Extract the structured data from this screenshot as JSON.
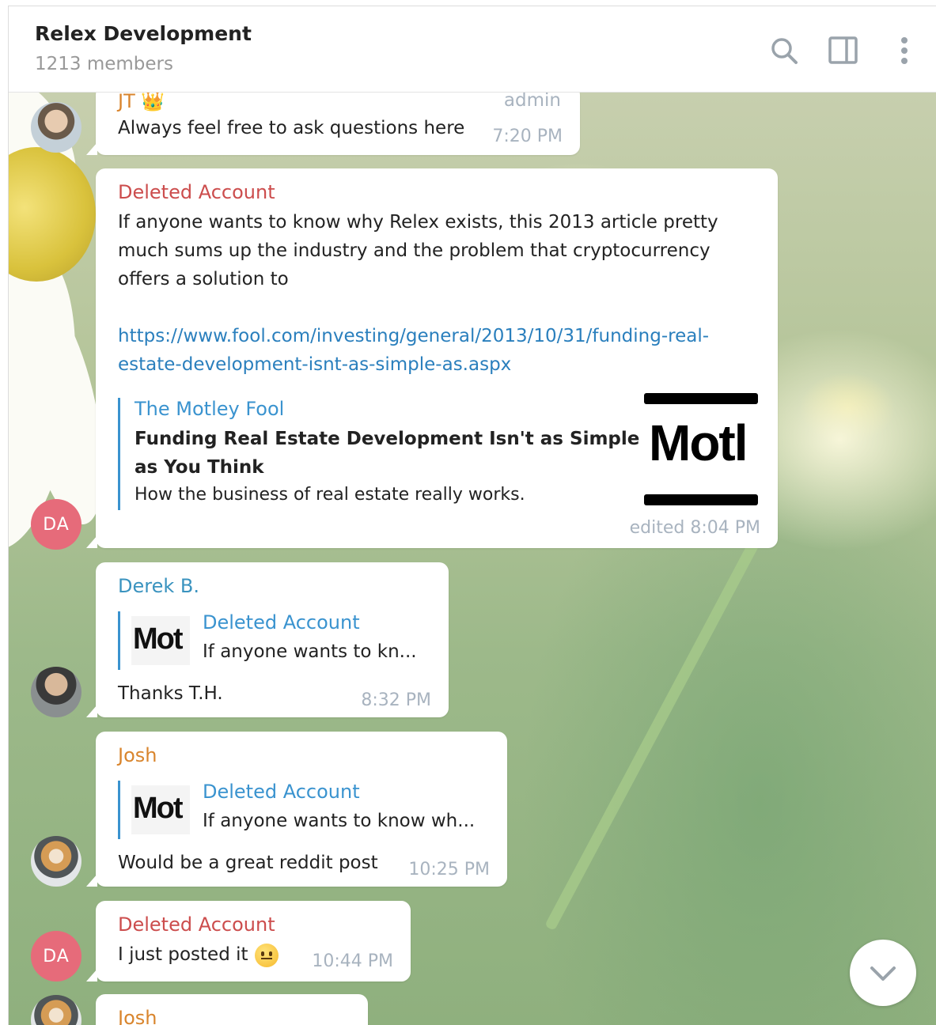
{
  "header": {
    "title": "Relex Development",
    "subtitle": "1213 members",
    "icons": [
      "search-icon",
      "sidebar-toggle-icon",
      "more-vertical-icon"
    ]
  },
  "messages": [
    {
      "sender": "JT 👑",
      "badge": "admin",
      "text": "Always feel free to ask questions here",
      "time": "7:20 PM",
      "sender_color": "#d9852d"
    },
    {
      "sender": "Deleted Account",
      "avatar_initials": "DA",
      "text_lines": [
        "If anyone wants to know why Relex exists, this 2013 article pretty",
        "much sums up the industry and the problem that cryptocurrency",
        "offers a solution to"
      ],
      "link_lines": [
        "https://www.fool.com/investing/general/2013/10/31/funding-real-",
        "estate-development-isnt-as-simple-as.aspx"
      ],
      "preview": {
        "site": "The Motley Fool",
        "title_lines": [
          "Funding Real Estate Development Isn't as Simple",
          "as You Think"
        ],
        "description": "How the business of real estate really works.",
        "thumb_text": "Motl"
      },
      "time": "edited 8:04 PM",
      "sender_color": "#cc4d4d"
    },
    {
      "sender": "Derek B.",
      "reply": {
        "thumb_text": "Mot",
        "name": "Deleted Account",
        "text": "If anyone wants to kn..."
      },
      "text": "Thanks T.H.",
      "time": "8:32 PM",
      "sender_color": "#3a93bf"
    },
    {
      "sender": "Josh",
      "reply": {
        "thumb_text": "Mot",
        "name": "Deleted Account",
        "text": "If anyone wants to know wh..."
      },
      "text": "Would be a great reddit post",
      "time": "10:25 PM",
      "sender_color": "#d9852d"
    },
    {
      "sender": "Deleted Account",
      "avatar_initials": "DA",
      "text": "I just posted it",
      "emoji": "slightly-smiling-face-emoji",
      "time": "10:44 PM",
      "sender_color": "#cc4d4d"
    },
    {
      "sender": "Josh",
      "sender_color": "#d9852d"
    }
  ],
  "scroll_button": {
    "icon": "chevron-down-icon"
  }
}
